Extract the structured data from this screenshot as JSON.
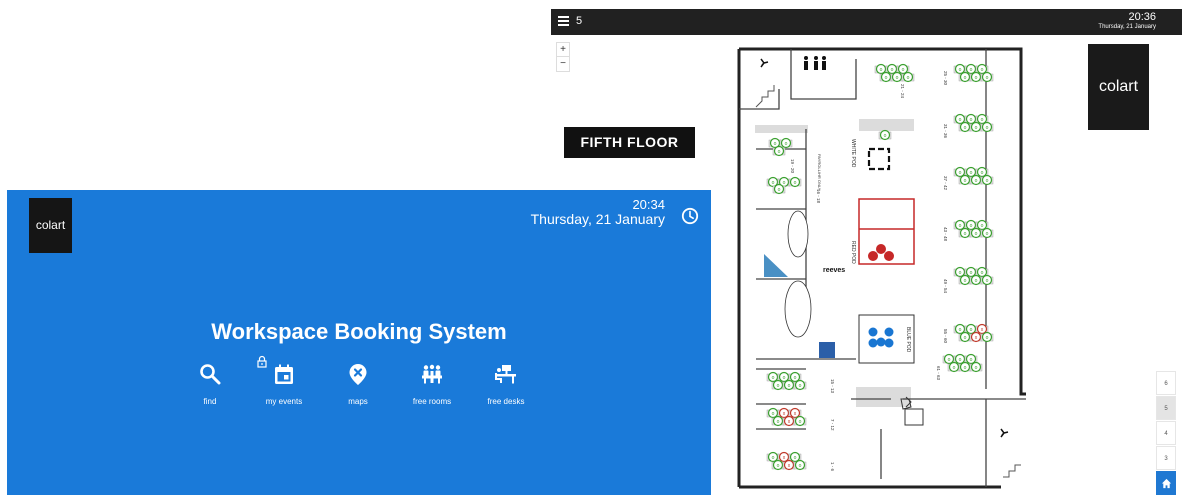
{
  "floor_plan_screen": {
    "current_floor": "5",
    "time": "20:36",
    "date": "Thursday, 21 January",
    "zoom_in_label": "+",
    "zoom_out_label": "−",
    "floor_title": "FIFTH FLOOR",
    "logo": "colart",
    "brand_label": "reeves",
    "pods": [
      "WHITE POD",
      "RED POD",
      "BLUE POD"
    ],
    "pod_note": "PAYROLL/HR ONLY",
    "desk_ranges": [
      "21 - 24",
      "25 - 30",
      "31 - 36",
      "37 - 42",
      "43 - 48",
      "49 - 54",
      "55 - 60",
      "61 - 63",
      "19 - 20",
      "16 - 18",
      "15 - 13",
      "7 - 12",
      "1 - 6"
    ],
    "floors": [
      "6",
      "5",
      "4",
      "3"
    ],
    "selected_floor": "5",
    "home_icon": "home-icon",
    "colors": {
      "topbar": "#212121",
      "free_desk": "#3aa02f",
      "booked_desk": "#c0392b",
      "red_pod": "#c62828",
      "blue_pod": "#1976d2"
    }
  },
  "booking_screen": {
    "logo": "colart",
    "time": "20:34",
    "date": "Thursday, 21 January",
    "title": "Workspace Booking System",
    "nav": [
      {
        "label": "find",
        "icon": "search-icon"
      },
      {
        "label": "my events",
        "icon": "calendar-icon"
      },
      {
        "label": "maps",
        "icon": "map-pin-icon"
      },
      {
        "label": "free rooms",
        "icon": "meeting-room-icon"
      },
      {
        "label": "free desks",
        "icon": "desk-icon"
      }
    ],
    "colors": {
      "background": "#1a7ad9"
    }
  }
}
